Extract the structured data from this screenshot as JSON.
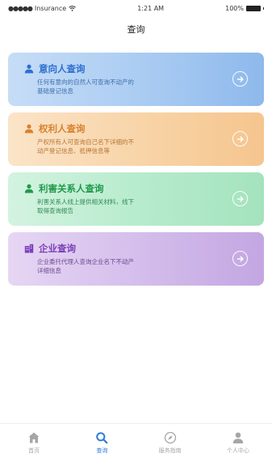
{
  "status_bar": {
    "signal": "●●●●●",
    "carrier": "Insurance",
    "time": "1:21 AM",
    "battery": "100%"
  },
  "nav": {
    "title": "查询"
  },
  "cards": [
    {
      "title": "意向人查询",
      "desc_line1": "任何有意向的自然人可查询不动产的",
      "desc_line2": "基础登记信息",
      "icon": "person-icon",
      "color": "#2e6fd0"
    },
    {
      "title": "权利人查询",
      "desc_line1": "产权所有人可查询自己名下详细的不",
      "desc_line2": "动产登记信息、抵押信息等",
      "icon": "person-icon",
      "color": "#d9822e"
    },
    {
      "title": "利害关系人查询",
      "desc_line1": "利害关系人线上提供相关材料，线下",
      "desc_line2": "取得查询报告",
      "icon": "person-icon",
      "color": "#1f9a4b"
    },
    {
      "title": "企业查询",
      "desc_line1": "企业委托代理人查询企业名下不动产",
      "desc_line2": "详细信息",
      "icon": "building-icon",
      "color": "#7a3fb8"
    }
  ],
  "tabs": [
    {
      "label": "首页",
      "icon": "home-icon",
      "active": false
    },
    {
      "label": "查询",
      "icon": "search-icon",
      "active": true
    },
    {
      "label": "服务指南",
      "icon": "compass-icon",
      "active": false
    },
    {
      "label": "个人中心",
      "icon": "user-icon",
      "active": false
    }
  ]
}
